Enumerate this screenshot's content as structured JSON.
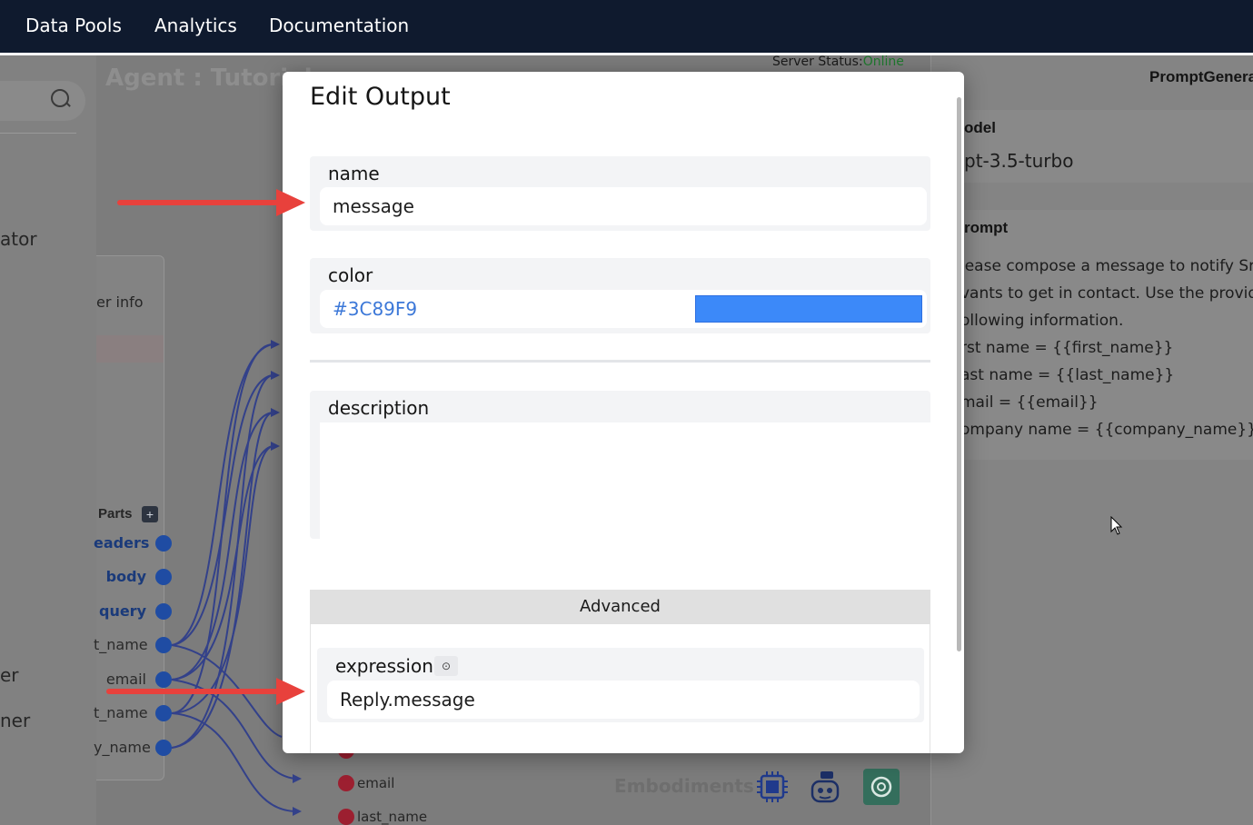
{
  "nav": {
    "items": [
      "Data Pools",
      "Analytics",
      "Documentation"
    ]
  },
  "background": {
    "agent_title": "Agent : Tutorial:",
    "server_status_label": "Server Status:",
    "server_status_value": "Online",
    "side_labels": [
      "ator",
      "er",
      "ner"
    ],
    "node": {
      "user_info_label": "er info",
      "parts_label": "Parts",
      "parts_add": "+",
      "ports": [
        "eaders",
        "body",
        "query",
        "t_name",
        "email",
        "t_name",
        "y_name"
      ],
      "output_ports": [
        "email",
        "last_name"
      ]
    },
    "embodiments_label": "Embodiments",
    "embodiment_icons": [
      "api-chip-icon",
      "robot-icon",
      "openai-icon"
    ]
  },
  "right_panel": {
    "title": "PromptGenera",
    "model_heading": "odel",
    "model_value": "pt-3.5-turbo",
    "prompt_heading": "rompt",
    "prompt_lines": [
      "lease compose a message to notify Sr",
      "vants to get in contact. Use the provide",
      "ollowing information.",
      "rst name = {{first_name}}",
      "ast name = {{last_name}}",
      "mail = {{email}}",
      "ompany name = {{company_name}}"
    ]
  },
  "modal": {
    "title": "Edit Output",
    "name_label": "name",
    "name_value": "message",
    "color_label": "color",
    "color_value": "#3C89F9",
    "swatch_color": "#3C89F9",
    "description_label": "description",
    "description_value": "",
    "advanced_label": "Advanced",
    "expression_label": "expression",
    "expression_info": "⊙",
    "expression_value": "Reply.message"
  },
  "colors": {
    "nav_bg": "#0f1a2e",
    "arrow": "#e8413c",
    "port_blue": "#1f4ca3",
    "port_red": "#9c1f30"
  }
}
